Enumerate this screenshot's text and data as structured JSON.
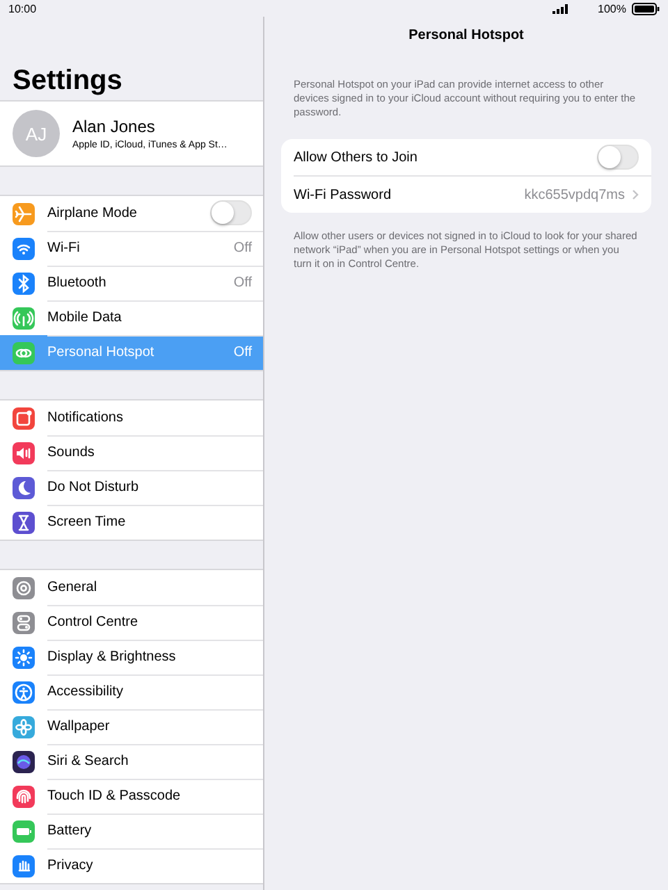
{
  "status_bar": {
    "time": "10:00",
    "battery": "100%"
  },
  "sidebar": {
    "title": "Settings",
    "profile": {
      "initials": "AJ",
      "name": "Alan Jones",
      "subtitle": "Apple ID, iCloud, iTunes & App St…"
    },
    "groups": [
      [
        {
          "label": "Airplane Mode",
          "kind": "toggle",
          "on": false,
          "selected": false,
          "color": "#f79a1e"
        },
        {
          "label": "Wi-Fi",
          "kind": "value",
          "value": "Off",
          "selected": false,
          "color": "#1a82fb"
        },
        {
          "label": "Bluetooth",
          "kind": "value",
          "value": "Off",
          "selected": false,
          "color": "#1a82fb"
        },
        {
          "label": "Mobile Data",
          "kind": "link",
          "selected": false,
          "color": "#35c759"
        },
        {
          "label": "Personal Hotspot",
          "kind": "value",
          "value": "Off",
          "selected": true,
          "color": "#35c759"
        }
      ],
      [
        {
          "label": "Notifications",
          "kind": "link",
          "selected": false,
          "color": "#f2453d"
        },
        {
          "label": "Sounds",
          "kind": "link",
          "selected": false,
          "color": "#f23a5a"
        },
        {
          "label": "Do Not Disturb",
          "kind": "link",
          "selected": false,
          "color": "#5d5ad6"
        },
        {
          "label": "Screen Time",
          "kind": "link",
          "selected": false,
          "color": "#5d4fd0"
        }
      ],
      [
        {
          "label": "General",
          "kind": "link",
          "selected": false,
          "color": "#8e8e93"
        },
        {
          "label": "Control Centre",
          "kind": "link",
          "selected": false,
          "color": "#8e8e93"
        },
        {
          "label": "Display & Brightness",
          "kind": "link",
          "selected": false,
          "color": "#1a82fb"
        },
        {
          "label": "Accessibility",
          "kind": "link",
          "selected": false,
          "color": "#1a82fb"
        },
        {
          "label": "Wallpaper",
          "kind": "link",
          "selected": false,
          "color": "#36aadc"
        },
        {
          "label": "Siri & Search",
          "kind": "link",
          "selected": false,
          "color": "#2b2350"
        },
        {
          "label": "Touch ID & Passcode",
          "kind": "link",
          "selected": false,
          "color": "#f23a5a"
        },
        {
          "label": "Battery",
          "kind": "link",
          "selected": false,
          "color": "#35c759"
        },
        {
          "label": "Privacy",
          "kind": "link",
          "selected": false,
          "color": "#1a82fb"
        }
      ]
    ]
  },
  "detail": {
    "title": "Personal Hotspot",
    "description": "Personal Hotspot on your iPad can provide internet access to other devices signed in to your iCloud account without requiring you to enter the password.",
    "rows": [
      {
        "label": "Allow Others to Join",
        "kind": "toggle",
        "on": false
      },
      {
        "label": "Wi-Fi Password",
        "kind": "value",
        "value": "kkc655vpdq7ms"
      }
    ],
    "footer": "Allow other users or devices not signed in to iCloud to look for your shared network “iPad” when you are in Personal Hotspot settings or when you turn it on in Control Centre."
  }
}
